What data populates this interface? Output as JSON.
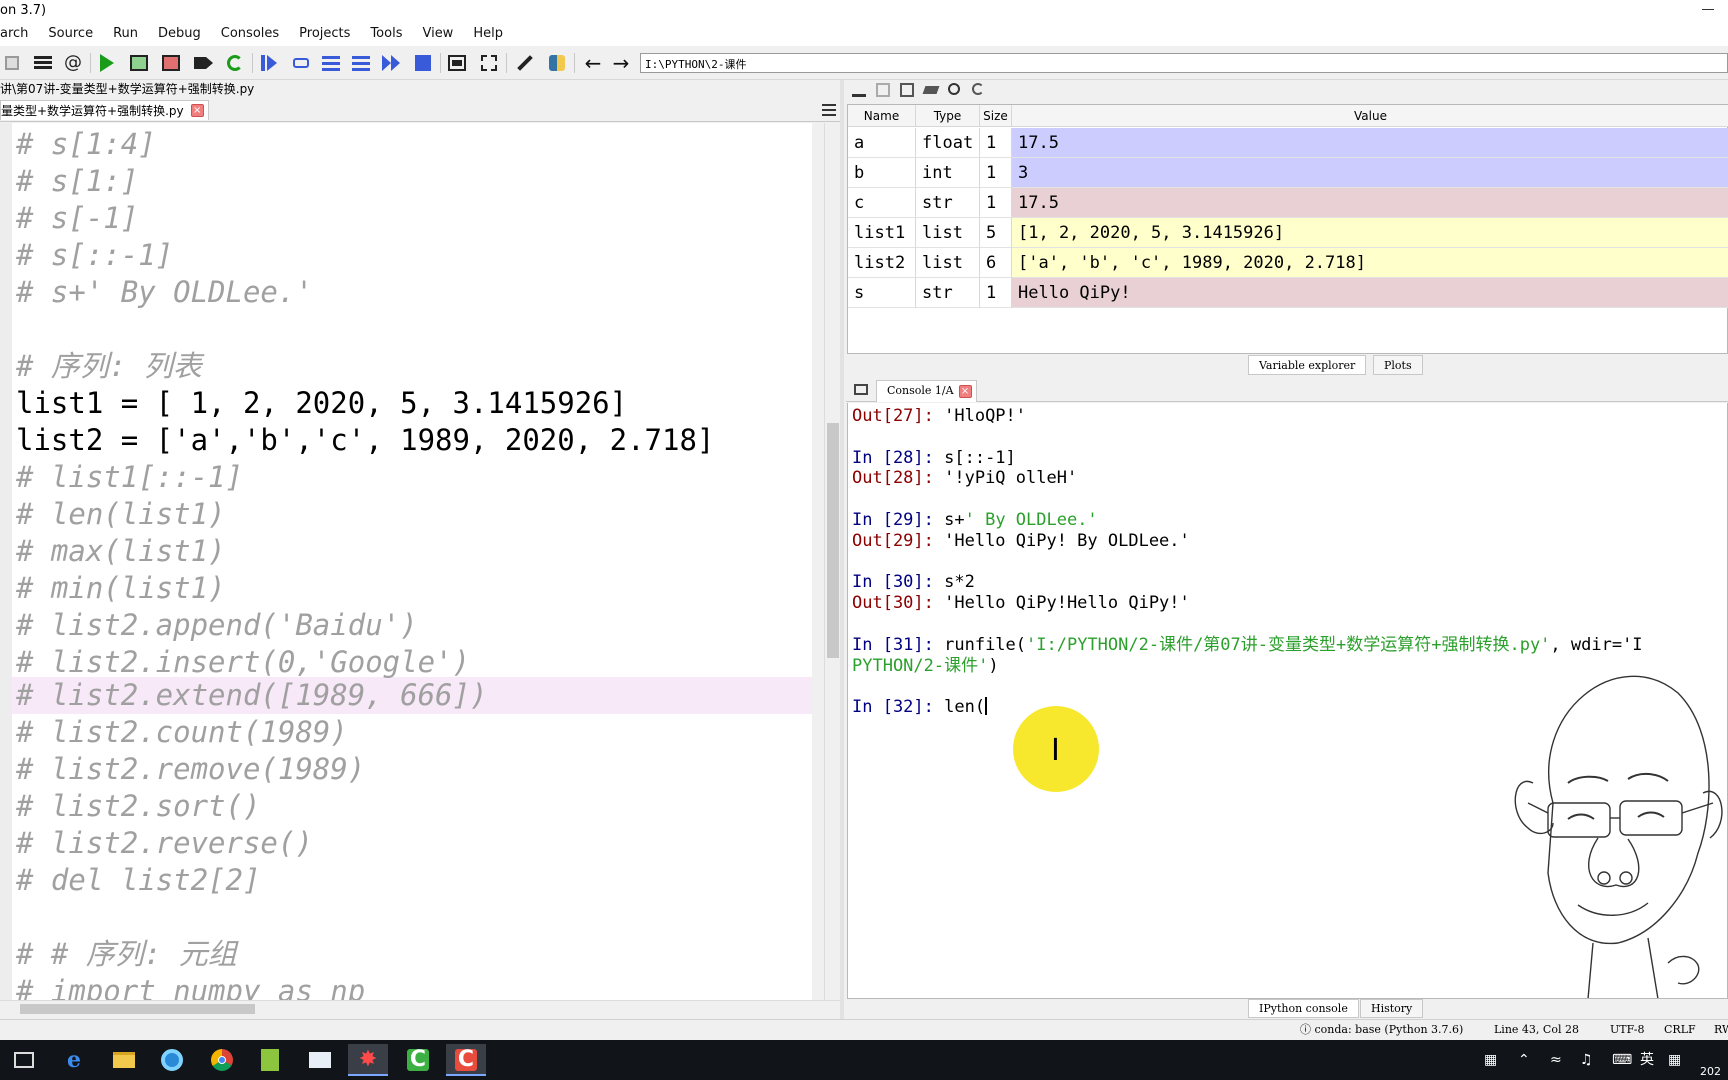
{
  "window": {
    "title_fragment": "on 3.7)"
  },
  "menu": [
    "arch",
    "Source",
    "Run",
    "Debug",
    "Consoles",
    "Projects",
    "Tools",
    "View",
    "Help"
  ],
  "toolbar": {
    "path": "I:\\PYTHON\\2-课件",
    "at_symbol": "@"
  },
  "editor": {
    "file_path": "讲\\第07讲-变量类型+数学运算符+强制转换.py",
    "tab_label": "量类型+数学运算符+强制转换.py",
    "lines": [
      "# s[1:4]",
      "# s[1:]",
      "# s[-1]",
      "# s[::-1]",
      "# s+' By OLDLee.'",
      "",
      "# 序列: 列表",
      "list1 = [ 1, 2, 2020, 5, 3.1415926]",
      "list2 = ['a','b','c', 1989, 2020, 2.718]",
      "# list1[::-1]",
      "# len(list1)",
      "# max(list1)",
      "# min(list1)",
      "# list2.append('Baidu')",
      "# list2.insert(0,'Google')",
      "# list2.extend([1989, 666])",
      "# list2.count(1989)",
      "# list2.remove(1989)",
      "# list2.sort()",
      "# list2.reverse()",
      "# del list2[2]",
      "",
      "# # 序列: 元组",
      "# import numpy as np"
    ],
    "highlight_line_index": 15
  },
  "variable_explorer": {
    "headers": [
      "Name",
      "Type",
      "Size",
      "Value"
    ],
    "rows": [
      {
        "name": "a",
        "type": "float",
        "size": "1",
        "value": "17.5",
        "color": "#ccccff"
      },
      {
        "name": "b",
        "type": "int",
        "size": "1",
        "value": "3",
        "color": "#ccccff"
      },
      {
        "name": "c",
        "type": "str",
        "size": "1",
        "value": "17.5",
        "color": "#e8d0d4"
      },
      {
        "name": "list1",
        "type": "list",
        "size": "5",
        "value": "[1, 2, 2020, 5, 3.1415926]",
        "color": "#ffffcc"
      },
      {
        "name": "list2",
        "type": "list",
        "size": "6",
        "value": "['a', 'b', 'c', 1989, 2020, 2.718]",
        "color": "#ffffcc"
      },
      {
        "name": "s",
        "type": "str",
        "size": "1",
        "value": "Hello QiPy!",
        "color": "#e8d0d4"
      }
    ],
    "tabs": [
      "Variable explorer",
      "Plots"
    ]
  },
  "console": {
    "tab_label": "Console 1/A",
    "tabs": [
      "IPython console",
      "History"
    ],
    "lines": [
      {
        "prompt": "Out[27]:",
        "kind": "out",
        "code": " 'HloQP!'"
      },
      {
        "prompt": "",
        "kind": "blank",
        "code": ""
      },
      {
        "prompt": "In [28]:",
        "kind": "in",
        "code": " s[::-1]"
      },
      {
        "prompt": "Out[28]:",
        "kind": "out",
        "code": " '!yPiQ olleH'"
      },
      {
        "prompt": "",
        "kind": "blank",
        "code": ""
      },
      {
        "prompt": "In [29]:",
        "kind": "in",
        "code": " s+",
        "str": "' By OLDLee.'"
      },
      {
        "prompt": "Out[29]:",
        "kind": "out",
        "code": " 'Hello QiPy! By OLDLee.'"
      },
      {
        "prompt": "",
        "kind": "blank",
        "code": ""
      },
      {
        "prompt": "In [30]:",
        "kind": "in",
        "code": " s*2"
      },
      {
        "prompt": "Out[30]:",
        "kind": "out",
        "code": " 'Hello QiPy!Hello QiPy!'"
      },
      {
        "prompt": "",
        "kind": "blank",
        "code": ""
      },
      {
        "prompt": "In [31]:",
        "kind": "in",
        "code": " runfile(",
        "str": "'I:/PYTHON/2-课件/第07讲-变量类型+数学运算符+强制转换.py'",
        "tail": ", wdir='I"
      },
      {
        "prompt": "",
        "kind": "cont",
        "code": "",
        "str": "PYTHON/2-课件'",
        "tail": ")"
      },
      {
        "prompt": "",
        "kind": "blank",
        "code": ""
      },
      {
        "prompt": "In [32]:",
        "kind": "in",
        "code": " len("
      }
    ]
  },
  "statusbar": {
    "env": "conda: base (Python 3.7.6)",
    "position": "Line 43, Col 28",
    "encoding": "UTF-8",
    "eol": "CRLF",
    "perm": "RW"
  },
  "taskbar": {
    "ime": "英",
    "clock": "202"
  }
}
